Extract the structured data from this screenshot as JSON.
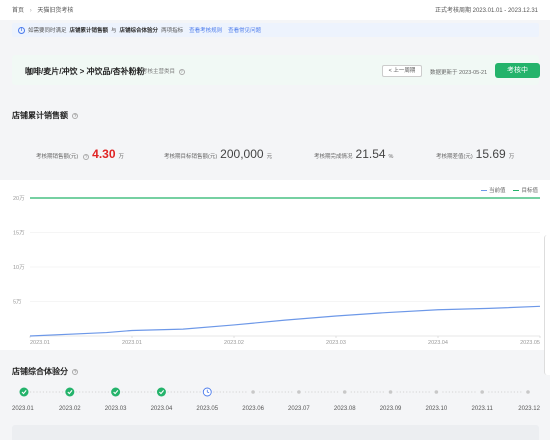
{
  "breadcrumb": {
    "home": "首页",
    "current": "天猫旧货考核"
  },
  "assessment_period": "正式考核周期 2023.01.01 - 2023.12.31",
  "notice": {
    "text1": "如需要同时满足",
    "metric1": "店铺累计销售额",
    "and": "与",
    "metric2": "店铺综合体验分",
    "text2": "两项指标",
    "link1": "查看考核规则",
    "link2": "查看常见问题"
  },
  "category": {
    "title": "咖啡/麦片/冲饮 > 冲饮品/杏补粉粉",
    "sub": "考核主营类目",
    "prev_button": "< 上一周期",
    "updated": "数据更新于 2023-05-21",
    "status": "考核中"
  },
  "sales_section_title": "店铺累计销售额",
  "stats": [
    {
      "label": "考核期销售额(元)",
      "value": "4.30",
      "unit": "万",
      "highlight": true
    },
    {
      "label": "考核期目标销售额(元)",
      "value": "200,000",
      "unit": "元",
      "highlight": false
    },
    {
      "label": "考核期完成情况",
      "value": "21.54",
      "unit": "%",
      "highlight": false
    },
    {
      "label": "考核期差值(元)",
      "value": "15.69",
      "unit": "万",
      "highlight": false
    }
  ],
  "legend": {
    "current": "当前值",
    "target": "目标值"
  },
  "colors": {
    "current": "#6d98e8",
    "target": "#24b36b",
    "primary": "#4b7bec",
    "success": "#24b36b",
    "alert": "#e02424"
  },
  "chart_data": {
    "type": "line",
    "x": [
      "2023.01",
      "2023.01",
      "2023.02",
      "2023.03",
      "2023.04",
      "2023.05"
    ],
    "y_ticks": [
      "5万",
      "10万",
      "15万",
      "20万"
    ],
    "ylim": [
      0,
      20
    ],
    "series": [
      {
        "name": "当前值",
        "points": [
          [
            0,
            0
          ],
          [
            0.15,
            0.5
          ],
          [
            0.2,
            0.8
          ],
          [
            0.3,
            1.0
          ],
          [
            0.4,
            1.6
          ],
          [
            0.5,
            2.3
          ],
          [
            0.6,
            2.9
          ],
          [
            0.7,
            3.4
          ],
          [
            0.8,
            3.8
          ],
          [
            0.9,
            4.0
          ],
          [
            1.0,
            4.3
          ]
        ]
      },
      {
        "name": "目标值",
        "points": [
          [
            0,
            20
          ],
          [
            1,
            20
          ]
        ]
      }
    ]
  },
  "score_section_title": "店铺综合体验分",
  "timeline": {
    "months": [
      "2023.01",
      "2023.02",
      "2023.03",
      "2023.04",
      "2023.05",
      "2023.06",
      "2023.07",
      "2023.08",
      "2023.09",
      "2023.10",
      "2023.11",
      "2023.12"
    ],
    "statuses": [
      "done",
      "done",
      "done",
      "done",
      "current",
      "pending",
      "pending",
      "pending",
      "pending",
      "pending",
      "pending",
      "pending"
    ]
  }
}
